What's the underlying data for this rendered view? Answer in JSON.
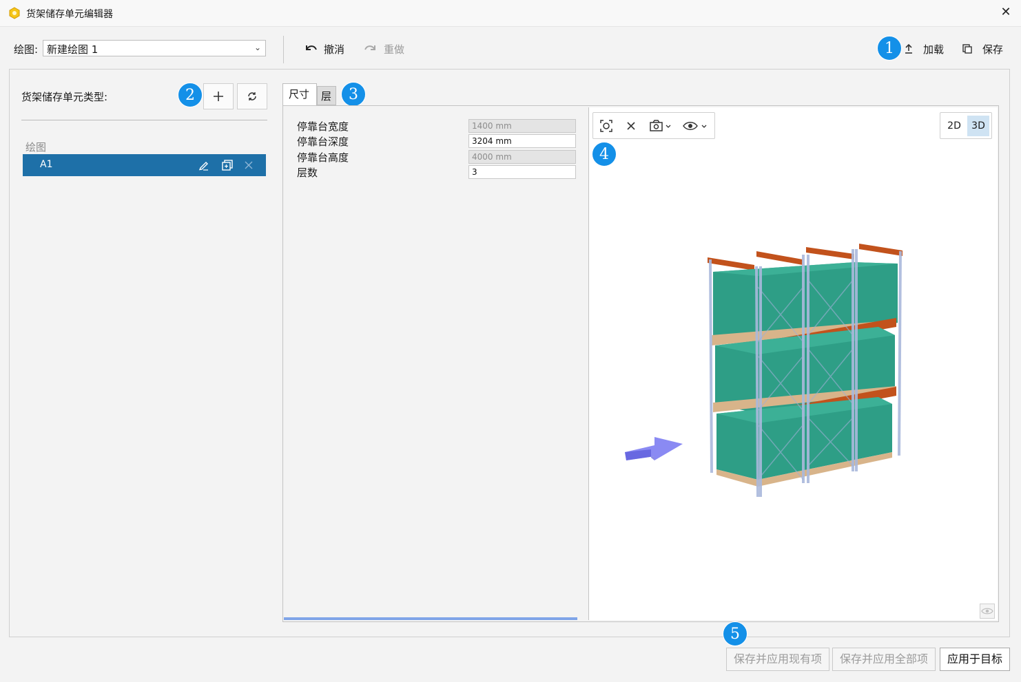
{
  "window": {
    "title": "货架储存单元编辑器"
  },
  "toolbar": {
    "drawing_label": "绘图:",
    "drawing_value": "新建绘图 1",
    "undo_label": "撤消",
    "redo_label": "重做",
    "load_label": "加载",
    "save_label": "保存"
  },
  "left_panel": {
    "section_title": "货架储存单元类型:",
    "group_label": "绘图",
    "items": [
      {
        "label": "A1",
        "selected": true
      }
    ]
  },
  "tabs": [
    {
      "label": "尺寸",
      "active": true
    },
    {
      "label": "层",
      "active": false
    }
  ],
  "properties": [
    {
      "label": "停靠台宽度",
      "value": "1400 mm",
      "enabled": false
    },
    {
      "label": "停靠台深度",
      "value": "3204 mm",
      "enabled": true
    },
    {
      "label": "停靠台高度",
      "value": "4000 mm",
      "enabled": false
    },
    {
      "label": "层数",
      "value": "3",
      "enabled": true
    }
  ],
  "viewport": {
    "view_2d_label": "2D",
    "view_3d_label": "3D",
    "active_view": "3D",
    "colors": {
      "box": "#2e9e86",
      "beam": "#c2521c",
      "upright": "#aab9dc",
      "pallet": "#d8b48a",
      "arrow": "#7070f0"
    }
  },
  "callouts": [
    "1",
    "2",
    "3",
    "4",
    "5"
  ],
  "footer": {
    "save_apply_existing": "保存并应用现有项",
    "save_apply_all": "保存并应用全部项",
    "apply_to_target": "应用于目标"
  },
  "accent_color": "#1e70a8",
  "callout_color": "#1490e8"
}
